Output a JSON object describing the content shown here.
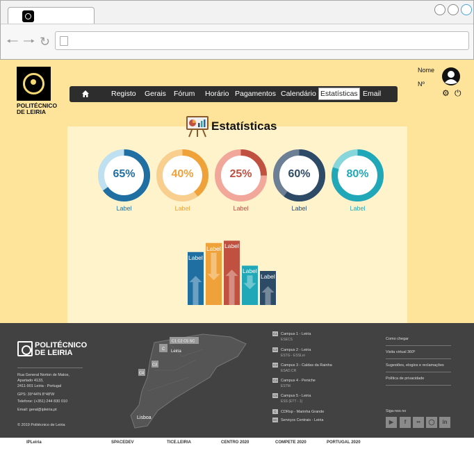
{
  "browser": {
    "tab_title": "",
    "address": ""
  },
  "header": {
    "logo_line1": "POLITÉCNICO",
    "logo_line2": "DE LEIRIA",
    "user_name_label": "Nome",
    "user_number_label": "Nº"
  },
  "nav": {
    "items": [
      {
        "label": "Registo"
      },
      {
        "label": "Gerais"
      },
      {
        "label": "Fórum"
      },
      {
        "label": "Horário"
      },
      {
        "label": "Pagamentos"
      },
      {
        "label": "Calendário"
      },
      {
        "label": "Estatísticas"
      },
      {
        "label": "Email"
      }
    ],
    "active": "Estatísticas"
  },
  "stats": {
    "title": "Estatísticas"
  },
  "chart_data": [
    {
      "type": "pie",
      "values": [
        65,
        40,
        25,
        60,
        80
      ],
      "value_labels": [
        "65%",
        "40%",
        "25%",
        "60%",
        "80%"
      ],
      "categories": [
        "Label",
        "Label",
        "Label",
        "Label",
        "Label"
      ],
      "colors": [
        "#1f6fa3",
        "#f0a23a",
        "#c0503f",
        "#2d4a66",
        "#21a8b8"
      ],
      "track_colors": [
        "#bfe0f0",
        "#f8cf8f",
        "#f2a79b",
        "#6c7f95",
        "#86d6dc"
      ]
    },
    {
      "type": "bar",
      "categories": [
        "Label",
        "Label",
        "Label",
        "Label",
        "Label"
      ],
      "values": [
        70,
        82,
        85,
        52,
        45
      ],
      "ylim": [
        0,
        90
      ],
      "colors": [
        "#1f6fa3",
        "#f0a23a",
        "#c0503f",
        "#21a8b8",
        "#2d4a66"
      ],
      "arrows": [
        "up",
        "down",
        "up",
        "down",
        "up"
      ]
    }
  ],
  "footer": {
    "logo_line1": "POLITÉCNICO",
    "logo_line2": "DE LEIRIA",
    "address_lines": [
      "Rua General Norton de Matos,",
      "Apartado 4133,",
      "2411-901 Leiria - Portugal"
    ],
    "gps": "GPS: 39°44'N 8°48'W",
    "phone": "Telefone: (+351) 244 830 010",
    "email": "Email: geral@ipleiria.pt",
    "copyright": "© 2019 Politécnico de Leiria",
    "map_labels": {
      "c1": "C1 C2 C5 SC",
      "leiria": "Leiria",
      "lisboa": "Lisboa",
      "c3": "C3",
      "c4": "C4",
      "c": "C"
    },
    "campuses": [
      {
        "badge": "C1",
        "name": "Campus 1 - Leiria",
        "sub": "ESECS"
      },
      {
        "badge": "C2",
        "name": "Campus 2 - Leiria",
        "sub": "ESTG - ESSLei"
      },
      {
        "badge": "C3",
        "name": "Campus 3 - Caldas da Rainha",
        "sub": "ESAD.CR"
      },
      {
        "badge": "C4",
        "name": "Campus 4 - Peniche",
        "sub": "ESTM"
      },
      {
        "badge": "C5",
        "name": "Campus 5 - Leiria",
        "sub": "ESS (ETT - 1)"
      },
      {
        "badge": "C",
        "name": "CDRsp - Marinha Grande",
        "sub": ""
      },
      {
        "badge": "SC",
        "name": "Serviços Centrais - Leiria",
        "sub": ""
      }
    ],
    "links": [
      "Como chegar",
      "Visita virtual 360º",
      "Sugestões, elogios e reclamações",
      "Política de privacidade"
    ],
    "follow_label": "Siga-nos no",
    "social": [
      "YouTube",
      "Facebook",
      "Flickr",
      "Instagram",
      "LinkedIn"
    ]
  },
  "partners": [
    "IPLeiria",
    "SPACEDEV",
    "TICE.LEIRIA",
    "CENTRO 2020",
    "COMPETE 2020",
    "PORTUGAL 2020"
  ]
}
